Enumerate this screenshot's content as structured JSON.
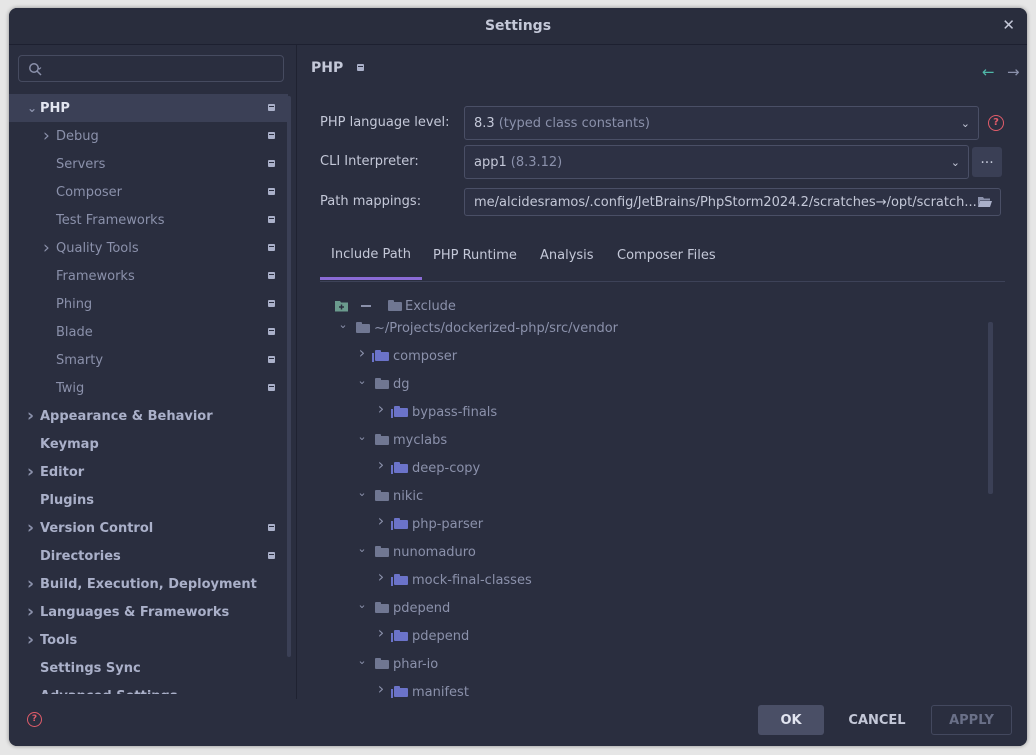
{
  "window": {
    "title": "Settings"
  },
  "search": {
    "placeholder": ""
  },
  "sidebar": {
    "items": [
      {
        "label": "PHP",
        "chevron": "down",
        "pinned": true,
        "bold": true,
        "selected": true,
        "indent": 0
      },
      {
        "label": "Debug",
        "chevron": "right",
        "pinned": true,
        "indent": 1
      },
      {
        "label": "Servers",
        "pinned": true,
        "indent": 1
      },
      {
        "label": "Composer",
        "pinned": true,
        "indent": 1
      },
      {
        "label": "Test Frameworks",
        "pinned": true,
        "indent": 1
      },
      {
        "label": "Quality Tools",
        "chevron": "right",
        "pinned": true,
        "indent": 1
      },
      {
        "label": "Frameworks",
        "pinned": true,
        "indent": 1
      },
      {
        "label": "Phing",
        "pinned": true,
        "indent": 1
      },
      {
        "label": "Blade",
        "pinned": true,
        "indent": 1
      },
      {
        "label": "Smarty",
        "pinned": true,
        "indent": 1
      },
      {
        "label": "Twig",
        "pinned": true,
        "indent": 1
      },
      {
        "label": "Appearance & Behavior",
        "chevron": "right",
        "bold": true,
        "indent": 0
      },
      {
        "label": "Keymap",
        "bold": true,
        "indent": 0
      },
      {
        "label": "Editor",
        "chevron": "right",
        "bold": true,
        "indent": 0
      },
      {
        "label": "Plugins",
        "bold": true,
        "indent": 0
      },
      {
        "label": "Version Control",
        "chevron": "right",
        "pinned": true,
        "bold": true,
        "indent": 0
      },
      {
        "label": "Directories",
        "pinned": true,
        "bold": true,
        "indent": 0
      },
      {
        "label": "Build, Execution, Deployment",
        "chevron": "right",
        "bold": true,
        "indent": 0
      },
      {
        "label": "Languages & Frameworks",
        "chevron": "right",
        "bold": true,
        "indent": 0
      },
      {
        "label": "Tools",
        "chevron": "right",
        "bold": true,
        "indent": 0
      },
      {
        "label": "Settings Sync",
        "bold": true,
        "indent": 0
      },
      {
        "label": "Advanced Settings",
        "bold": true,
        "indent": 0
      }
    ]
  },
  "page": {
    "title": "PHP",
    "back_icon": "arrow-left-icon",
    "forward_icon": "arrow-right-icon",
    "language_level": {
      "label": "PHP language level:",
      "value": "8.3",
      "hint": "(typed class constants)"
    },
    "cli": {
      "label": "CLI Interpreter:",
      "value": "app1",
      "hint": "(8.3.12)",
      "more": "..."
    },
    "path_mappings": {
      "label": "Path mappings:",
      "value": "me/alcidesramos/.config/JetBrains/PhpStorm2024.2/scratches→/opt/scratch..."
    },
    "tabs": [
      {
        "label": "Include Path",
        "active": true
      },
      {
        "label": "PHP Runtime"
      },
      {
        "label": "Analysis"
      },
      {
        "label": "Composer Files"
      }
    ],
    "toolbar": {
      "exclude_label": "Exclude"
    },
    "tree": [
      {
        "label": "~/Projects/dockerized-php/src/vendor",
        "chevron": "down",
        "icon": "folder",
        "level": 0
      },
      {
        "label": "composer",
        "chevron": "right",
        "icon": "library",
        "level": 1
      },
      {
        "label": "dg",
        "chevron": "down",
        "icon": "folder",
        "level": 1
      },
      {
        "label": "bypass-finals",
        "chevron": "right",
        "icon": "library",
        "level": 2
      },
      {
        "label": "myclabs",
        "chevron": "down",
        "icon": "folder",
        "level": 1
      },
      {
        "label": "deep-copy",
        "chevron": "right",
        "icon": "library",
        "level": 2
      },
      {
        "label": "nikic",
        "chevron": "down",
        "icon": "folder",
        "level": 1
      },
      {
        "label": "php-parser",
        "chevron": "right",
        "icon": "library",
        "level": 2
      },
      {
        "label": "nunomaduro",
        "chevron": "down",
        "icon": "folder",
        "level": 1
      },
      {
        "label": "mock-final-classes",
        "chevron": "right",
        "icon": "library",
        "level": 2
      },
      {
        "label": "pdepend",
        "chevron": "down",
        "icon": "folder",
        "level": 1
      },
      {
        "label": "pdepend",
        "chevron": "right",
        "icon": "library",
        "level": 2
      },
      {
        "label": "phar-io",
        "chevron": "down",
        "icon": "folder",
        "level": 1
      },
      {
        "label": "manifest",
        "chevron": "right",
        "icon": "library",
        "level": 2
      }
    ]
  },
  "footer": {
    "ok": "OK",
    "cancel": "CANCEL",
    "apply": "APPLY"
  },
  "colors": {
    "background": "#2a2e3f",
    "selection": "#3b4056",
    "accent": "#8a6bd6",
    "help": "#e05c6a",
    "nav_back": "#4fb7a8"
  }
}
